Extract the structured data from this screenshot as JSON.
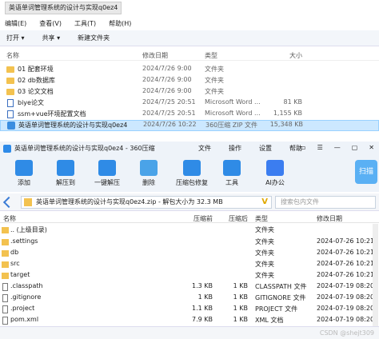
{
  "explorer": {
    "path": "英语单词管理系统的设计与实现q0ez4",
    "menu": [
      "编辑(E)",
      "查看(V)",
      "工具(T)",
      "帮助(H)"
    ],
    "toolbar": [
      "打开 ▾",
      "共享 ▾",
      "新建文件夹"
    ],
    "columns": {
      "name": "名称",
      "date": "修改日期",
      "type": "类型",
      "size": "大小"
    },
    "rows": [
      {
        "icon": "folder",
        "name": "01 配套环境",
        "date": "2024/7/26 9:00",
        "type": "文件夹",
        "size": ""
      },
      {
        "icon": "folder",
        "name": "02 db数据库",
        "date": "2024/7/26 9:00",
        "type": "文件夹",
        "size": ""
      },
      {
        "icon": "folder",
        "name": "03 论文文档",
        "date": "2024/7/26 9:00",
        "type": "文件夹",
        "size": ""
      },
      {
        "icon": "doc",
        "name": "biye论文",
        "date": "2024/7/25 20:51",
        "type": "Microsoft Word ...",
        "size": "81 KB"
      },
      {
        "icon": "doc",
        "name": "ssm+vue环境配置文档",
        "date": "2024/7/25 20:51",
        "type": "Microsoft Word ...",
        "size": "1,155 KB"
      },
      {
        "icon": "zip",
        "name": "英语单词管理系统的设计与实现q0ez4",
        "date": "2024/7/26 10:22",
        "type": "360压缩 ZIP 文件",
        "size": "15,348 KB",
        "selected": true
      }
    ]
  },
  "zip": {
    "title": "英语单词管理系统的设计与实现q0ez4 - 360压缩",
    "tabs": [
      "文件",
      "操作",
      "设置",
      "帮助"
    ],
    "window_controls": [
      "▭",
      "☰",
      "—",
      "▢",
      "✕"
    ],
    "tools": [
      "添加",
      "解压到",
      "一键解压",
      "删除",
      "压缩包修复",
      "工具",
      "AI办公"
    ],
    "scan": "扫描",
    "path": "英语单词管理系统的设计与实现q0ez4.zip - 解包大小为 32.3 MB",
    "path_badge": "V",
    "search_placeholder": "搜索包内文件",
    "columns": {
      "name": "名称",
      "compressed": "压缩前",
      "size": "压缩后",
      "type": "类型",
      "date": "修改日期"
    },
    "rows": [
      {
        "icon": "folder",
        "name": ".. (上级目录)",
        "compressed": "",
        "size": "",
        "type": "文件夹",
        "date": ""
      },
      {
        "icon": "folder",
        "name": ".settings",
        "compressed": "",
        "size": "",
        "type": "文件夹",
        "date": "2024-07-26 10:21"
      },
      {
        "icon": "folder",
        "name": "db",
        "compressed": "",
        "size": "",
        "type": "文件夹",
        "date": "2024-07-26 10:21"
      },
      {
        "icon": "folder",
        "name": "src",
        "compressed": "",
        "size": "",
        "type": "文件夹",
        "date": "2024-07-26 10:21"
      },
      {
        "icon": "folder",
        "name": "target",
        "compressed": "",
        "size": "",
        "type": "文件夹",
        "date": "2024-07-26 10:21"
      },
      {
        "icon": "file",
        "name": ".classpath",
        "compressed": "1.3 KB",
        "size": "1 KB",
        "type": "CLASSPATH 文件",
        "date": "2024-07-19 08:20"
      },
      {
        "icon": "file",
        "name": ".gitignore",
        "compressed": "1 KB",
        "size": "1 KB",
        "type": "GITIGNORE 文件",
        "date": "2024-07-19 08:20"
      },
      {
        "icon": "file",
        "name": ".project",
        "compressed": "1.1 KB",
        "size": "1 KB",
        "type": "PROJECT 文件",
        "date": "2024-07-19 08:20"
      },
      {
        "icon": "file",
        "name": "pom.xml",
        "compressed": "7.9 KB",
        "size": "1 KB",
        "type": "XML 文档",
        "date": "2024-07-19 08:20"
      }
    ],
    "watermark": "CSDN @shejt309"
  }
}
